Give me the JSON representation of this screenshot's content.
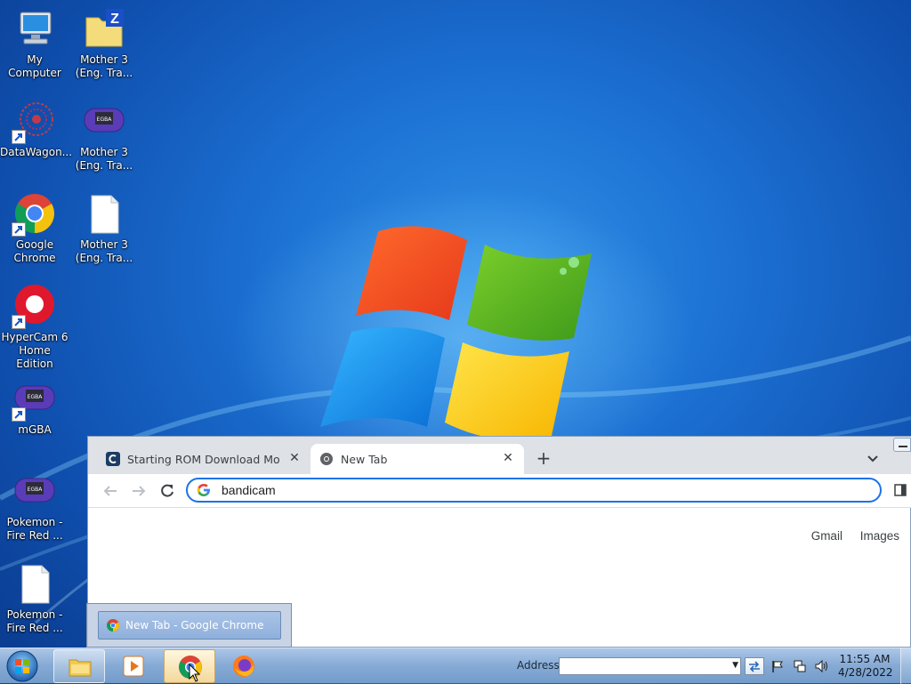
{
  "desktop": {
    "icons": [
      {
        "label_1": "My Computer",
        "label_2": ""
      },
      {
        "label_1": "Mother 3",
        "label_2": "(Eng. Tra..."
      },
      {
        "label_1": "DataWagon...",
        "label_2": ""
      },
      {
        "label_1": "Mother 3",
        "label_2": "(Eng. Tra..."
      },
      {
        "label_1": "Google",
        "label_2": "Chrome"
      },
      {
        "label_1": "Mother 3",
        "label_2": "(Eng. Tra..."
      },
      {
        "label_1": "HyperCam 6",
        "label_2": "Home Edition"
      },
      {
        "label_1": "mGBA",
        "label_2": ""
      },
      {
        "label_1": "Pokemon -",
        "label_2": "Fire Red ..."
      },
      {
        "label_1": "Pokemon -",
        "label_2": "Fire Red ..."
      }
    ]
  },
  "chrome": {
    "tabs": [
      {
        "title": "Starting ROM Download Mother",
        "favicon": "site-c-icon",
        "close": "✕"
      },
      {
        "title": "New Tab",
        "favicon": "chrome-icon",
        "close": "✕"
      }
    ],
    "new_tab_glyph": "+",
    "omnibox_value": "bandicam",
    "links": {
      "gmail": "Gmail",
      "images": "Images"
    }
  },
  "thumbnail": {
    "title": "New Tab - Google Chrome"
  },
  "taskbar": {
    "address_label": "Address",
    "address_value": "",
    "clock_time": "11:55 AM",
    "clock_date": "4/28/2022"
  },
  "colors": {
    "accent": "#1a73e8",
    "desktop_blue": "#1b6fd1",
    "tabstrip": "#dee1e6"
  }
}
